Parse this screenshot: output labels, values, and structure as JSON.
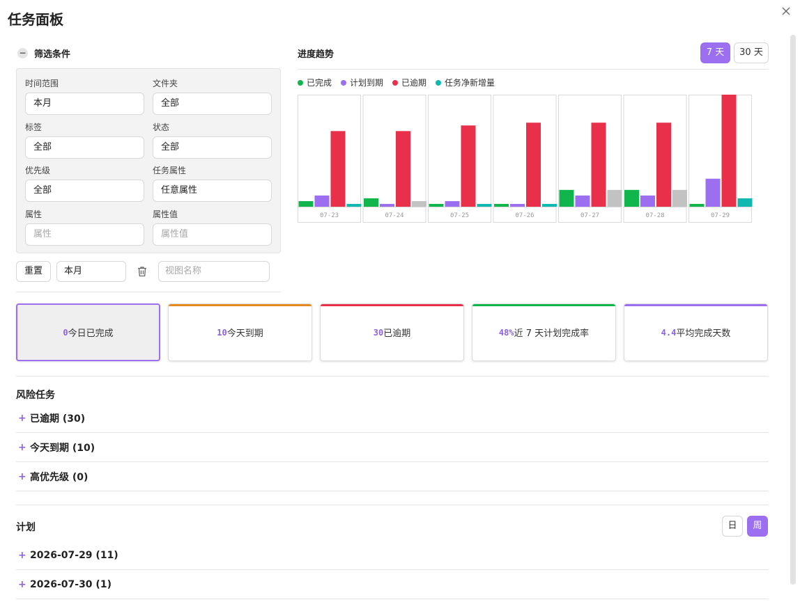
{
  "page": {
    "title": "任务面板"
  },
  "filter": {
    "header": "筛选条件",
    "fields": [
      {
        "label": "时间范围",
        "value": "本月"
      },
      {
        "label": "文件夹",
        "value": "全部"
      },
      {
        "label": "标签",
        "value": "全部"
      },
      {
        "label": "状态",
        "value": "全部"
      },
      {
        "label": "优先级",
        "value": "全部"
      },
      {
        "label": "任务属性",
        "value": "任意属性"
      },
      {
        "label": "属性",
        "placeholder": "属性"
      },
      {
        "label": "属性值",
        "placeholder": "属性值"
      }
    ],
    "reset_label": "重置",
    "view_select": "本月",
    "view_name_placeholder": "视图名称"
  },
  "trend": {
    "title": "进度趋势",
    "range_buttons": [
      "7 天",
      "30 天"
    ],
    "active_range": "7 天"
  },
  "chart_data": {
    "type": "bar",
    "categories": [
      "07-23",
      "07-24",
      "07-25",
      "07-26",
      "07-27",
      "07-28",
      "07-29"
    ],
    "series": [
      {
        "name": "已完成",
        "color": "#10b64c",
        "values": [
          2,
          3,
          1,
          1,
          6,
          6,
          1
        ]
      },
      {
        "name": "计划到期",
        "color": "#9b6ff0",
        "values": [
          4,
          1,
          2,
          1,
          4,
          4,
          10
        ]
      },
      {
        "name": "已逾期",
        "color": "#e8304a",
        "values": [
          27,
          27,
          29,
          30,
          30,
          30,
          40
        ]
      },
      {
        "name": "任务净新增量",
        "color": "#11b8b0",
        "values": [
          1,
          2,
          1,
          1,
          6,
          6,
          3
        ]
      }
    ],
    "ylim": [
      0,
      40
    ]
  },
  "stats": [
    {
      "value": "0",
      "label": "今日已完成",
      "color": "#9b6ff0"
    },
    {
      "value": "10",
      "label": "今天到期",
      "color": "#e58a1f"
    },
    {
      "value": "30",
      "label": "已逾期",
      "color": "#e8304a"
    },
    {
      "value": "48%",
      "label": "近 7 天计划完成率",
      "color": "#10b64c"
    },
    {
      "value": "4.4",
      "label": "平均完成天数",
      "color": "#9b6ff0"
    }
  ],
  "risk": {
    "title": "风险任务",
    "rows": [
      "已逾期 (30)",
      "今天到期 (10)",
      "高优先级 (0)"
    ]
  },
  "plan": {
    "title": "计划",
    "buttons": [
      "日",
      "周"
    ],
    "active": "周",
    "rows": [
      "2026-07-29 (11)",
      "2026-07-30 (1)"
    ]
  }
}
